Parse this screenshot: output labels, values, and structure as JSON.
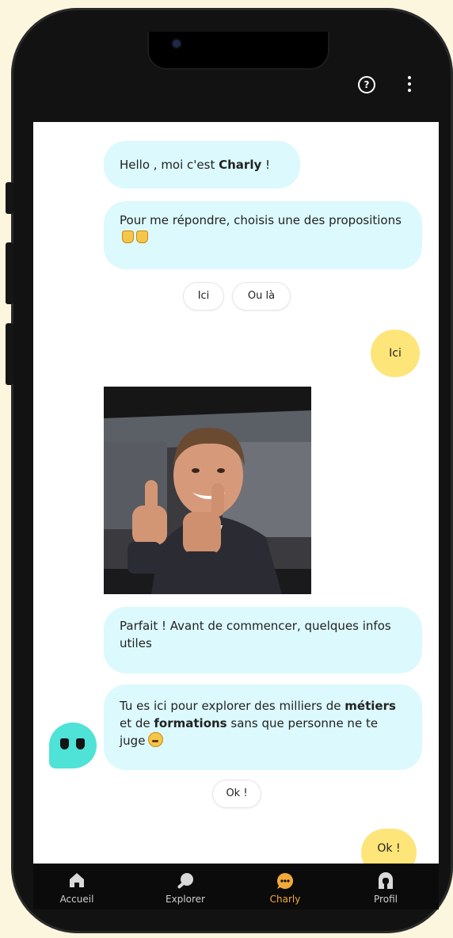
{
  "header": {
    "help_icon": "question-circle-icon",
    "more_icon": "vertical-dots-icon"
  },
  "messages": {
    "m1_pre": "Hello , moi c'est ",
    "m1_bold": "Charly",
    "m1_post": " !",
    "m2": "Pour me répondre, choisis une des propositions",
    "choices_1": [
      "Ici",
      "Ou là"
    ],
    "user_reply_1": "Ici",
    "m3": "Parfait ! Avant de commencer, quelques infos utiles",
    "m4_a": "Tu es ici pour explorer des milliers de ",
    "m4_b": "métiers",
    "m4_c": " et de ",
    "m4_d": "formations",
    "m4_e": " sans que personne ne te juge",
    "choices_2": [
      "Ok !"
    ],
    "user_reply_2": "Ok !"
  },
  "nav": {
    "items": [
      {
        "label": "Accueil",
        "icon": "home-icon"
      },
      {
        "label": "Explorer",
        "icon": "search-icon"
      },
      {
        "label": "Charly",
        "icon": "chat-bubble-icon"
      },
      {
        "label": "Profil",
        "icon": "user-icon"
      }
    ]
  },
  "colors": {
    "bot_bubble": "#dcf9fd",
    "user_bubble": "#fde57a",
    "accent": "#f2a93b",
    "avatar": "#4ee3d6",
    "page_background": "#fdf6de"
  }
}
